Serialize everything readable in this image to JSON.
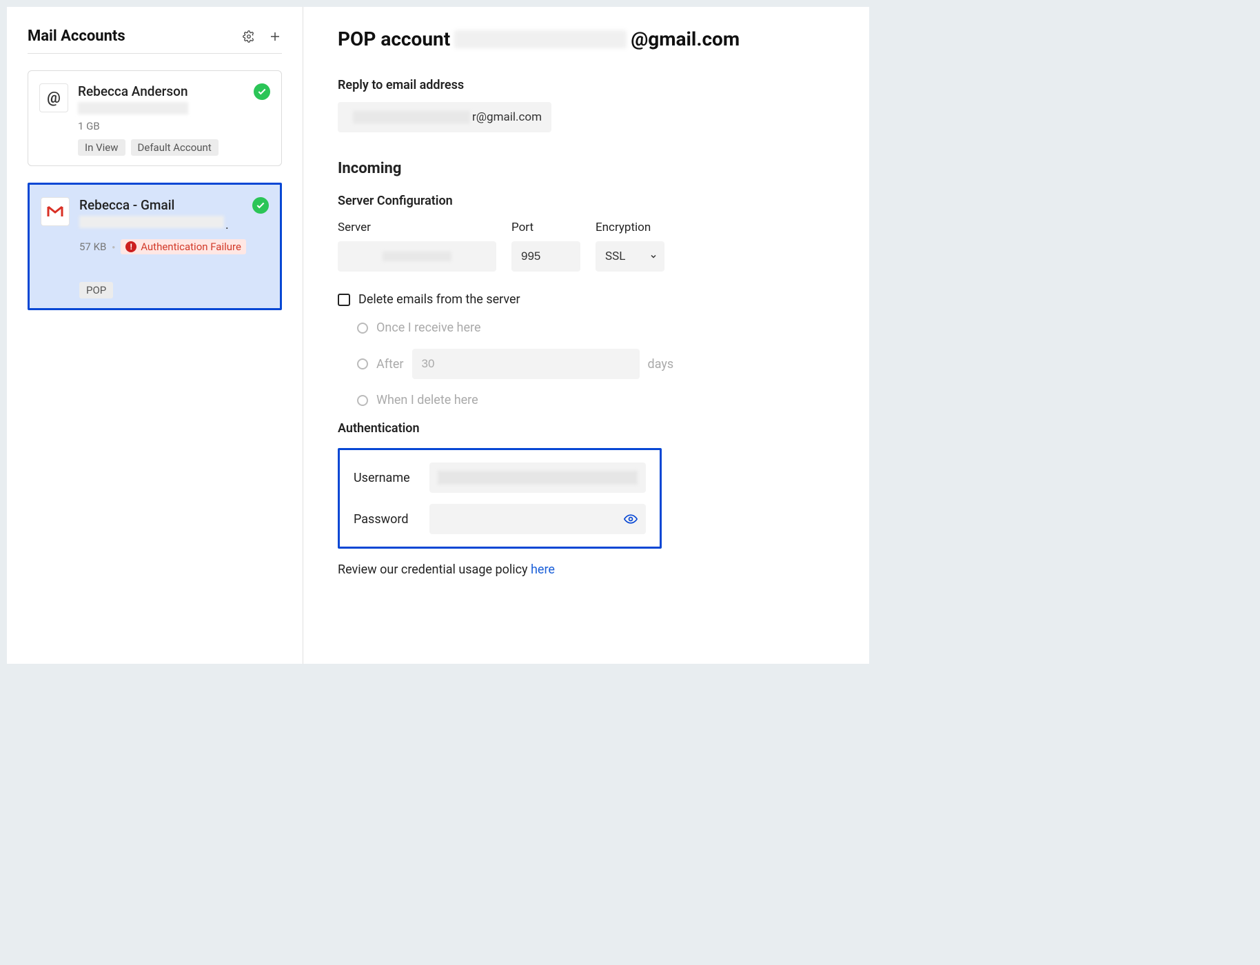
{
  "sidebar": {
    "title": "Mail Accounts",
    "accounts": [
      {
        "name": "Rebecca Anderson",
        "size": "1 GB",
        "tags": [
          "In View",
          "Default Account"
        ],
        "avatar_glyph": "@",
        "status": "ok"
      },
      {
        "name": "Rebecca - Gmail",
        "size": "57 KB",
        "alert": "Authentication Failure",
        "tags": [
          "POP"
        ],
        "avatar_glyph": "M",
        "status": "ok"
      }
    ]
  },
  "main": {
    "title_prefix": "POP account",
    "title_suffix": "@gmail.com",
    "reply_label": "Reply to email address",
    "reply_suffix": "r@gmail.com",
    "incoming_label": "Incoming",
    "server_config_label": "Server Configuration",
    "cols": {
      "server": "Server",
      "port": "Port",
      "encryption": "Encryption"
    },
    "port_value": "995",
    "encryption_value": "SSL",
    "delete_label": "Delete emails from the server",
    "radio_once": "Once I receive here",
    "radio_after_prefix": "After",
    "radio_after_value": "30",
    "radio_after_suffix": "days",
    "radio_delete": "When I delete here",
    "auth_label": "Authentication",
    "auth_username": "Username",
    "auth_password": "Password",
    "policy_text": "Review our credential usage policy ",
    "policy_link": "here"
  }
}
